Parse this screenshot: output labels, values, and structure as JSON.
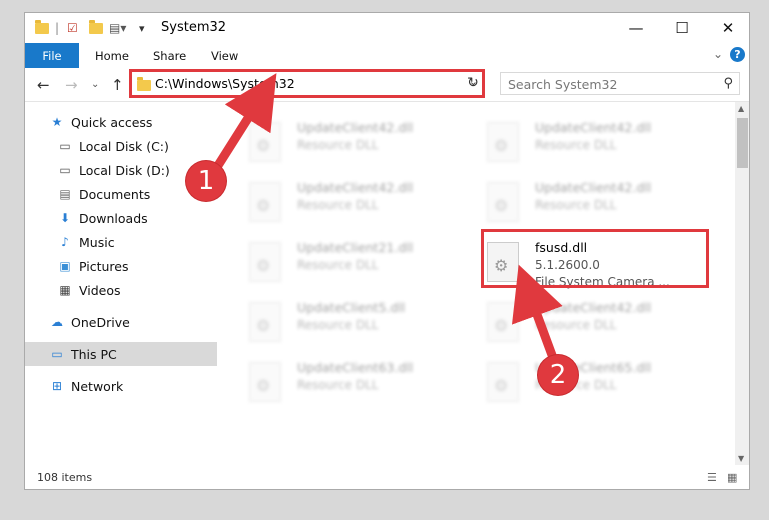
{
  "window": {
    "title": "System32",
    "controls": {
      "minimize": "—",
      "maximize": "☐",
      "close": "✕"
    }
  },
  "ribbon": {
    "tabs": [
      "File",
      "Home",
      "Share",
      "View"
    ],
    "help": "?"
  },
  "nav": {
    "address": "C:\\Windows\\System32",
    "search_placeholder": "Search System32"
  },
  "sidebar": {
    "items": [
      {
        "label": "Quick access",
        "icon": "star-icon"
      },
      {
        "label": "Local Disk (C:)",
        "icon": "drive-icon",
        "pinned": true
      },
      {
        "label": "Local Disk (D:)",
        "icon": "drive-icon"
      },
      {
        "label": "Documents",
        "icon": "documents-icon"
      },
      {
        "label": "Downloads",
        "icon": "download-icon",
        "pinned": true
      },
      {
        "label": "Music",
        "icon": "music-icon",
        "pinned": true
      },
      {
        "label": "Pictures",
        "icon": "pictures-icon",
        "pinned": true
      },
      {
        "label": "Videos",
        "icon": "videos-icon",
        "pinned": true
      },
      {
        "label": "OneDrive",
        "icon": "cloud-icon"
      },
      {
        "label": "This PC",
        "icon": "computer-icon",
        "selected": true
      },
      {
        "label": "Network",
        "icon": "network-icon"
      }
    ]
  },
  "files": [
    {
      "name": "UpdateClient42.dll",
      "desc": "Resource DLL"
    },
    {
      "name": "UpdateClient42.dll",
      "desc": "Resource DLL"
    },
    {
      "name": "UpdateClient42.dll",
      "desc": "Resource DLL"
    },
    {
      "name": "UpdateClient42.dll",
      "desc": "Resource DLL"
    },
    {
      "name": "UpdateClient21.dll",
      "desc": "Resource DLL"
    },
    {
      "name": "fsusd.dll",
      "desc": "5.1.2600.0",
      "desc2": "File System Camera ..."
    },
    {
      "name": "UpdateClient5.dll",
      "desc": "Resource DLL"
    },
    {
      "name": "UpdateClient42.dll",
      "desc": "Resource DLL"
    },
    {
      "name": "UpdateClient63.dll",
      "desc": "Resource DLL"
    },
    {
      "name": "UpdateClient65.dll",
      "desc": "Resource DLL"
    }
  ],
  "status": {
    "items": "108 items"
  },
  "callouts": {
    "one": "1",
    "two": "2"
  },
  "colors": {
    "accent": "#1979ca",
    "highlight": "#e0393e"
  }
}
